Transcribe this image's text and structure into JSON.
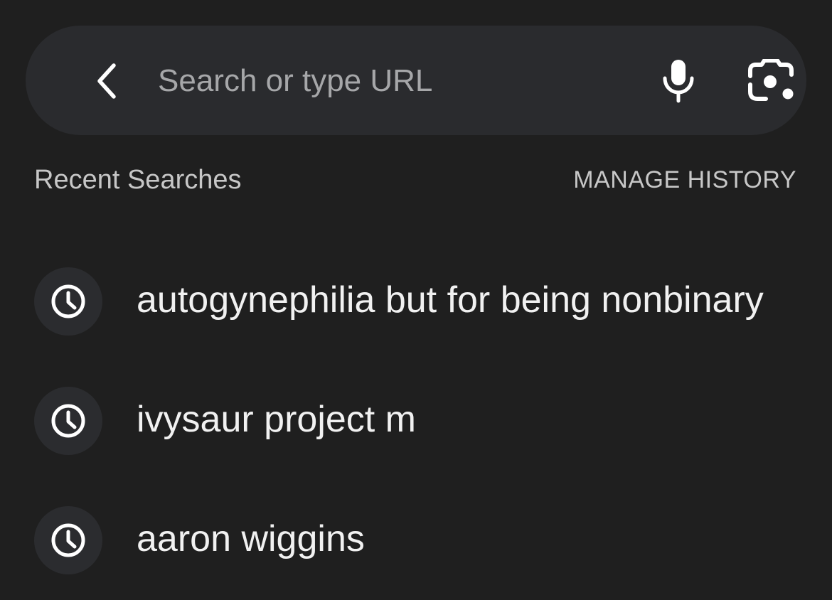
{
  "search_bar": {
    "placeholder": "Search or type URL",
    "value": "",
    "back_icon": "chevron-left-icon",
    "mic_icon": "microphone-icon",
    "lens_icon": "google-lens-icon"
  },
  "recent": {
    "title": "Recent Searches",
    "manage_label": "MANAGE HISTORY",
    "items": [
      {
        "label": "autogynephilia but for being nonbinary",
        "icon": "history-clock-icon"
      },
      {
        "label": "ivysaur project m",
        "icon": "history-clock-icon"
      },
      {
        "label": "aaron wiggins",
        "icon": "history-clock-icon"
      }
    ]
  },
  "colors": {
    "background": "#1f1f1f",
    "search_bar": "#2a2b2e",
    "icon_circle": "#2b2c2f",
    "text_primary": "#f1f1f1",
    "text_secondary": "#c7c7c7",
    "placeholder": "#a6a7a9"
  }
}
